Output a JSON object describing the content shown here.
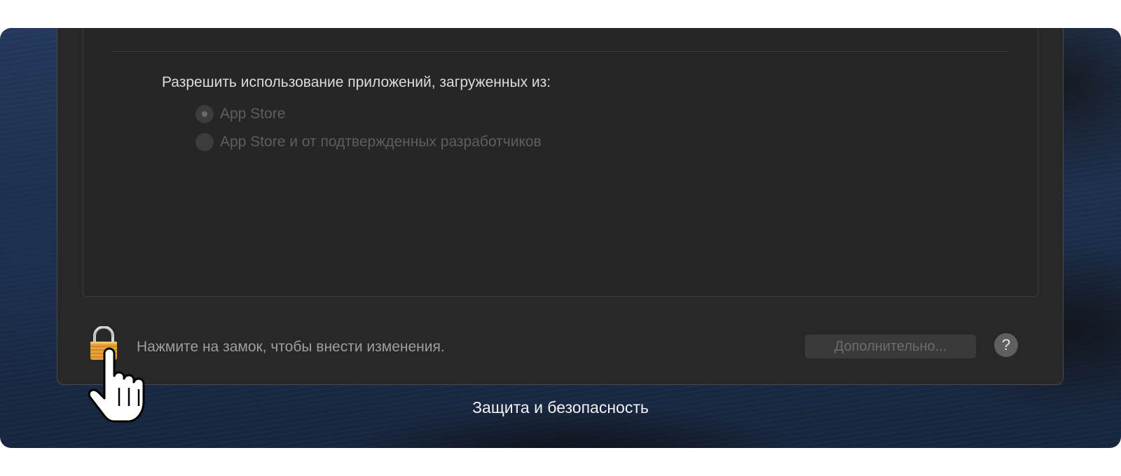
{
  "window": {
    "caption": "Защита и безопасность"
  },
  "gatekeeper": {
    "heading": "Разрешить использование приложений, загруженных из:",
    "options": [
      {
        "label": "App Store",
        "selected": true
      },
      {
        "label": "App Store и от подтвержденных разработчиков",
        "selected": false
      }
    ]
  },
  "footer": {
    "lock_hint": "Нажмите на замок, чтобы внести изменения.",
    "advanced_label": "Дополнительно...",
    "help_label": "?"
  },
  "icons": {
    "lock": "lock-icon",
    "cursor": "pointing-hand-cursor-icon"
  },
  "colors": {
    "lock_body": "#e9a23b",
    "window_bg": "#282828"
  }
}
